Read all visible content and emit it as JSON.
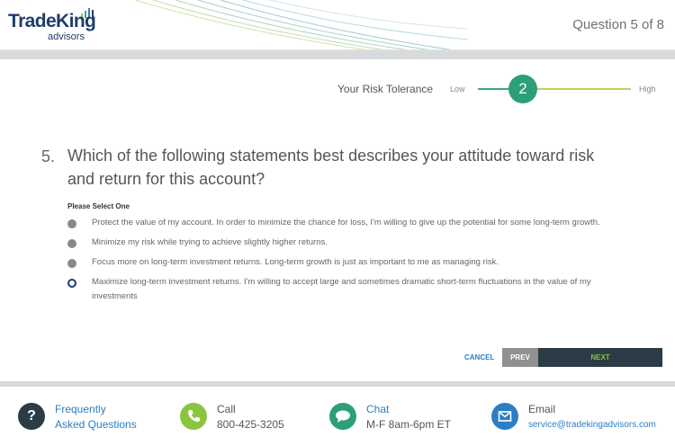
{
  "header": {
    "logo_brand": "TradeKing",
    "logo_sub": "advisors",
    "question_count": "Question 5 of 8"
  },
  "risk_tolerance": {
    "title": "Your Risk Tolerance",
    "low_label": "Low",
    "level": "2",
    "high_label": "High"
  },
  "question": {
    "number": "5.",
    "text": "Which of the following statements best describes your attitude toward risk and return for this account?",
    "instruction": "Please Select One",
    "options": [
      {
        "label": "Protect the value of my account. In order to minimize the chance for loss, I'm willing to give up the potential for some long-term growth.",
        "selected": false
      },
      {
        "label": "Minimize my risk while trying to achieve slightly higher returns.",
        "selected": false
      },
      {
        "label": "Focus more on long-term investment returns. Long-term growth is just as important to me as managing risk.",
        "selected": false
      },
      {
        "label": "Maximize long-term investment returns. I'm willing to accept large and sometimes dramatic short-term fluctuations in the value of my investments",
        "selected": true
      }
    ]
  },
  "nav": {
    "cancel": "CANCEL",
    "prev": "PREV",
    "next": "NEXT"
  },
  "footer": {
    "faq": {
      "line1": "Frequently",
      "line2": "Asked Questions",
      "icon": "question-icon",
      "color": "#2b3c47"
    },
    "call": {
      "line1": "Call",
      "line2": "800-425-3205",
      "icon": "phone-icon",
      "color": "#8bc53f"
    },
    "chat": {
      "line1": "Chat",
      "line2": "M-F 8am-6pm ET",
      "icon": "chat-icon",
      "color": "#2c9e7a"
    },
    "email": {
      "line1": "Email",
      "line2": "service@tradekingadvisors.com",
      "icon": "email-icon",
      "color": "#2b7ec3"
    }
  },
  "colors": {
    "brand_navy": "#1f3d6b",
    "accent_green": "#2c9e7a",
    "next_bg": "#2b3c47",
    "next_text": "#8bc53f"
  }
}
